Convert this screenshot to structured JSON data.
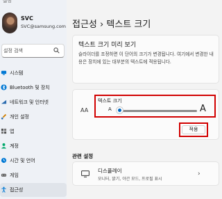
{
  "app": {
    "title": "설정"
  },
  "user": {
    "name": "SVC",
    "email": "SVC@samsung.com"
  },
  "search": {
    "placeholder": "설정 검색"
  },
  "sidebar": {
    "items": [
      {
        "label": "시스템",
        "icon": "monitor-icon",
        "color": "#0078d4"
      },
      {
        "label": "Bluetooth 및 장치",
        "icon": "bluetooth-icon",
        "color": "#0078d4"
      },
      {
        "label": "네트워크 및 인터넷",
        "icon": "wifi-icon",
        "color": "#2b6cb0"
      },
      {
        "label": "개인 설정",
        "icon": "brush-icon",
        "color": "#d08000"
      },
      {
        "label": "앱",
        "icon": "apps-icon",
        "color": "#555555"
      },
      {
        "label": "계정",
        "icon": "person-icon",
        "color": "#00a86b"
      },
      {
        "label": "시간 및 언어",
        "icon": "globe-clock-icon",
        "color": "#0078d4"
      },
      {
        "label": "게임",
        "icon": "gamepad-icon",
        "color": "#555555"
      },
      {
        "label": "접근성",
        "icon": "accessibility-icon",
        "color": "#0078d4",
        "active": true
      }
    ]
  },
  "breadcrumb": {
    "parent": "접근성",
    "separator": "›",
    "current": "텍스트 크기"
  },
  "preview": {
    "title": "텍스트 크기 미리 보기",
    "body": "슬라이더를 조정하면 이 단어의 크기가 변경됩니다. 여기에서 변경한 내용은 장치에 있는 대부분의 텍스트에 적용됩니다."
  },
  "text_size": {
    "icon_text": "AA",
    "label": "텍스트 크기",
    "small_marker": "A",
    "large_marker": "A",
    "slider_value": 0.0,
    "apply_label": "적용"
  },
  "related": {
    "title": "관련 설정",
    "display": {
      "title": "디스플레이",
      "subtitle": "모니터, 밝기, 야간 모드, 프로필 표시"
    }
  },
  "colors": {
    "accent": "#0067c0",
    "highlight": "#d10000"
  }
}
